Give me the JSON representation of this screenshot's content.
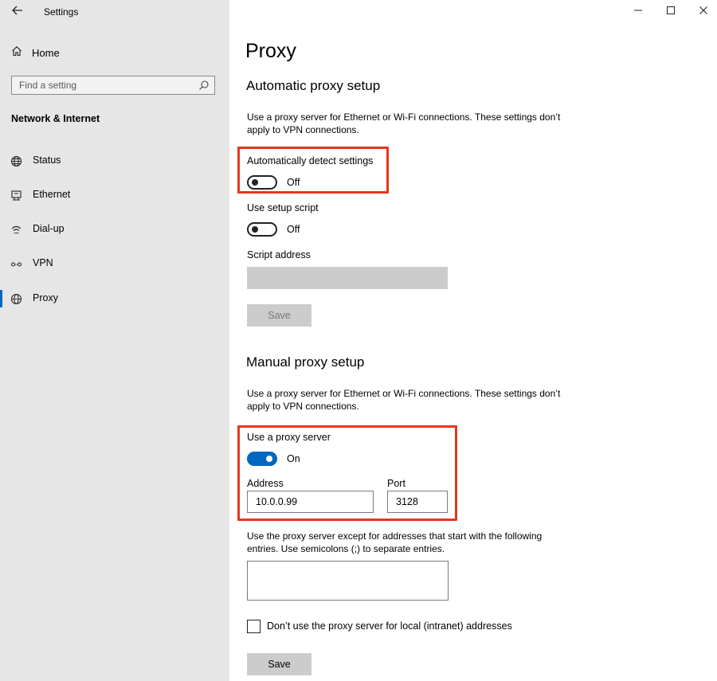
{
  "window": {
    "title": "Settings",
    "back_icon": "arrow-left",
    "controls": [
      "minimize-icon",
      "maximize-icon",
      "close-icon"
    ]
  },
  "sidebar": {
    "home_label": "Home",
    "search_placeholder": "Find a setting",
    "section_title": "Network & Internet",
    "items": [
      {
        "label": "Status",
        "icon": "globe-status-icon",
        "selected": false
      },
      {
        "label": "Ethernet",
        "icon": "ethernet-icon",
        "selected": false
      },
      {
        "label": "Dial-up",
        "icon": "dialup-icon",
        "selected": false
      },
      {
        "label": "VPN",
        "icon": "vpn-icon",
        "selected": false
      },
      {
        "label": "Proxy",
        "icon": "globe-icon",
        "selected": true
      }
    ],
    "accent_color": "#0067c0"
  },
  "main": {
    "title": "Proxy",
    "auto": {
      "heading": "Automatic proxy setup",
      "description": "Use a proxy server for Ethernet or Wi-Fi connections. These settings don’t apply to VPN connections.",
      "detect_label": "Automatically detect settings",
      "detect_state": "Off",
      "script_label": "Use setup script",
      "script_state": "Off",
      "address_label": "Script address",
      "save_label": "Save"
    },
    "manual": {
      "heading": "Manual proxy setup",
      "description": "Use a proxy server for Ethernet or Wi-Fi connections. These settings don’t apply to VPN connections.",
      "use_proxy_label": "Use a proxy server",
      "use_proxy_state": "On",
      "address_label": "Address",
      "address_value": "10.0.0.99",
      "port_label": "Port",
      "port_value": "3128",
      "exceptions_description": "Use the proxy server except for addresses that start with the following entries. Use semicolons (;) to separate entries.",
      "exceptions_value": "",
      "local_checkbox_label": "Don’t use the proxy server for local (intranet) addresses",
      "local_checkbox_checked": false,
      "save_label": "Save"
    },
    "highlight_color": "#e8361d"
  }
}
